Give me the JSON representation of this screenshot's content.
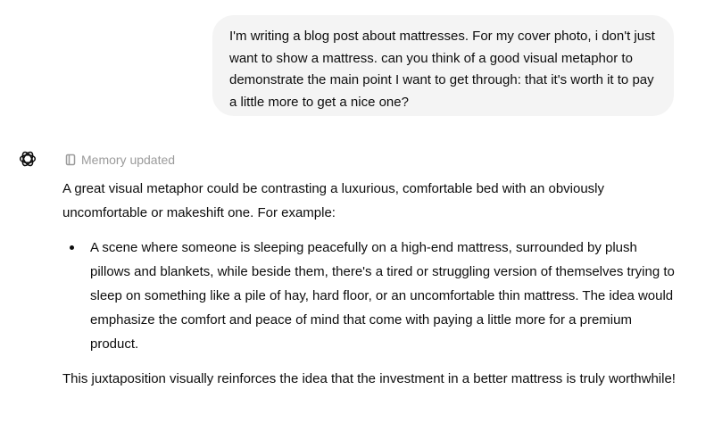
{
  "user_message": {
    "text": "I'm writing a blog post about mattresses. For my cover photo, i don't just want to show a mattress. can you think of a good visual metaphor to demonstrate the main point I want to get through: that it's worth it to pay a little more to get a nice one?"
  },
  "assistant": {
    "avatar_icon": "openai-logo-icon",
    "memory_status": {
      "icon": "memory-book-icon",
      "label": "Memory updated"
    },
    "intro": "A great visual metaphor could be contrasting a luxurious, comfortable bed with an obviously uncomfortable or makeshift one. For example:",
    "bullets": [
      "A scene where someone is sleeping peacefully on a high-end mattress, surrounded by plush pillows and blankets, while beside them, there's a tired or struggling version of themselves trying to sleep on something like a pile of hay, hard floor, or an uncomfortable thin mattress. The idea would emphasize the comfort and peace of mind that come with paying a little more for a premium product."
    ],
    "conclusion": "This juxtaposition visually reinforces the idea that the investment in a better mattress is truly worthwhile!"
  }
}
